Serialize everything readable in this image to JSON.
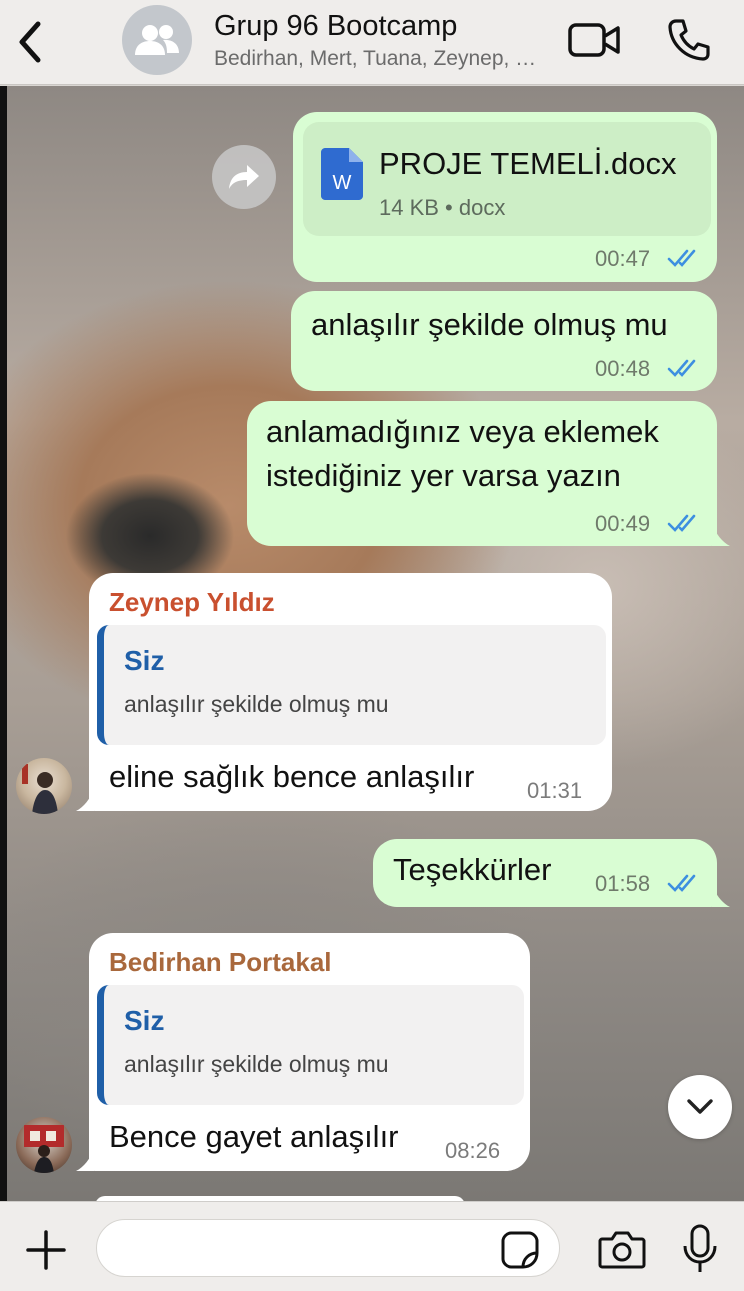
{
  "header": {
    "title": "Grup 96 Bootcamp",
    "subtitle": "Bedirhan, Mert, Tuana, Zeynep, Siz"
  },
  "messages": [
    {
      "type": "document",
      "file_name": "PROJE TEMELİ.docx",
      "file_meta": "14 KB • docx",
      "time": "00:47"
    },
    {
      "type": "outgoing",
      "text": "anlaşılır şekilde olmuş mu",
      "time": "00:48"
    },
    {
      "type": "outgoing",
      "lines": [
        "anlamadığınız veya eklemek",
        "istediğiniz yer varsa yazın"
      ],
      "time": "00:49"
    },
    {
      "type": "incoming",
      "sender": "Zeynep Yıldız",
      "sender_color": "#c9502f",
      "quote_author": "Siz",
      "quote_text": "anlaşılır şekilde olmuş mu",
      "text": "eline sağlık bence anlaşılır",
      "time": "01:31"
    },
    {
      "type": "outgoing",
      "text": "Teşekkürler",
      "time": "01:58"
    },
    {
      "type": "incoming",
      "sender": "Bedirhan Portakal",
      "sender_color": "#a9683c",
      "quote_author": "Siz",
      "quote_text": "anlaşılır şekilde olmuş mu",
      "text": "Bence gayet anlaşılır",
      "time": "08:26"
    }
  ],
  "colors": {
    "outgoing_bubble": "#d9fdd3",
    "incoming_bubble": "#ffffff",
    "read_ticks": "#3d8fe0",
    "quote_accent": "#1f5fa8"
  },
  "icons": [
    "back-chevron-icon",
    "group-avatar-icon",
    "video-call-icon",
    "phone-icon",
    "forward-icon",
    "word-document-icon",
    "read-receipt-icon",
    "chevron-down-icon",
    "plus-icon",
    "sticker-icon",
    "camera-icon",
    "microphone-icon"
  ],
  "input": {
    "value": "",
    "placeholder": ""
  }
}
